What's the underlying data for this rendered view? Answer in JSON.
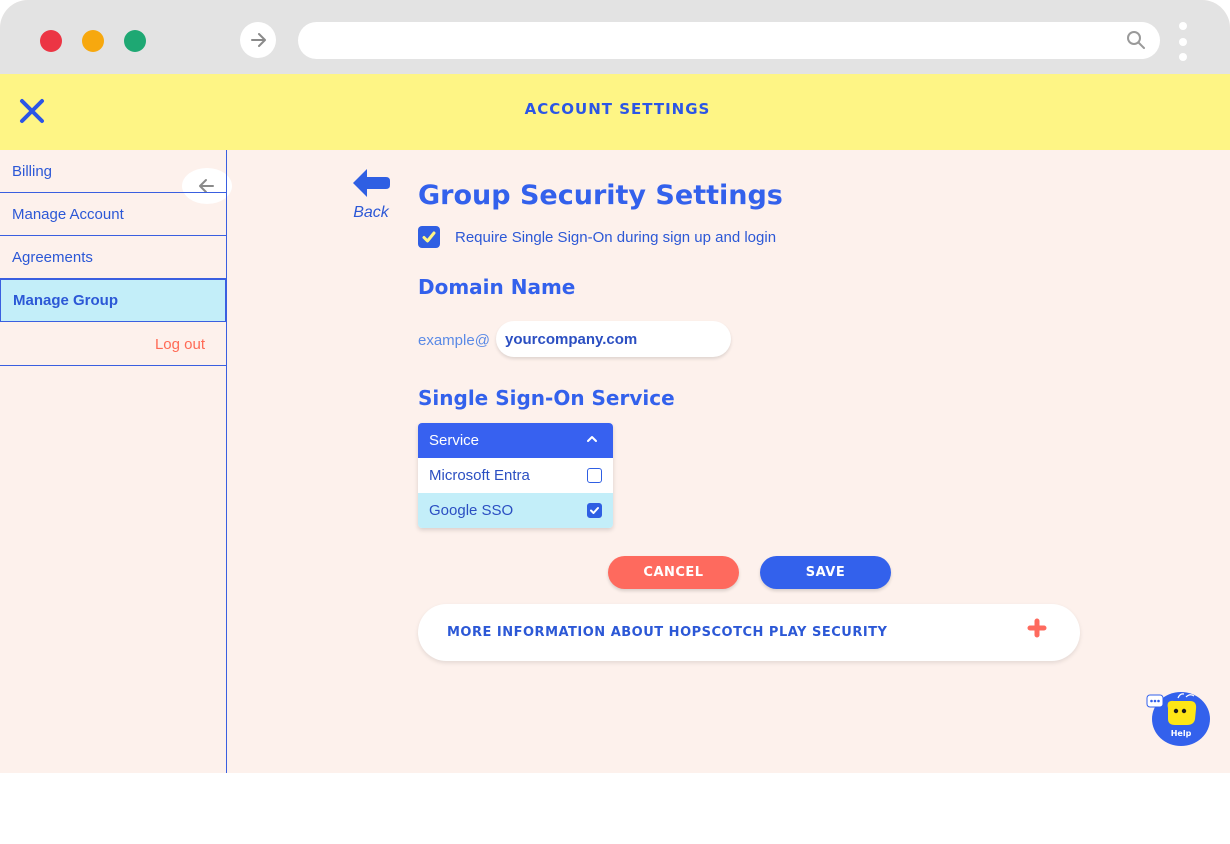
{
  "browser": {
    "url": ""
  },
  "header": {
    "title": "ACCOUNT SETTINGS"
  },
  "sidebar": {
    "items": [
      {
        "label": "Billing"
      },
      {
        "label": "Manage Account"
      },
      {
        "label": "Agreements"
      },
      {
        "label": "Manage Group",
        "active": true
      }
    ],
    "logout_label": "Log out"
  },
  "main": {
    "back_label": "Back",
    "title": "Group Security Settings",
    "require_sso": {
      "label": "Require Single Sign-On during sign up and login",
      "checked": true
    },
    "domain_heading": "Domain Name",
    "domain_prefix": "example@",
    "domain_value": "yourcompany.com",
    "sso_heading": "Single Sign-On Service",
    "dropdown": {
      "header": "Service",
      "options": [
        {
          "label": "Microsoft Entra",
          "checked": false
        },
        {
          "label": "Google SSO",
          "checked": true
        }
      ]
    },
    "cancel_label": "CANCEL",
    "save_label": "SAVE",
    "more_info_label": "MORE INFORMATION ABOUT HOPSCOTCH PLAY SECURITY"
  },
  "help": {
    "label": "Help"
  },
  "colors": {
    "accent": "#3361ec",
    "header_bg": "#fef585",
    "page_bg": "#fdf1ec",
    "cancel": "#fe6a5e",
    "active_item": "#c3eef9"
  }
}
